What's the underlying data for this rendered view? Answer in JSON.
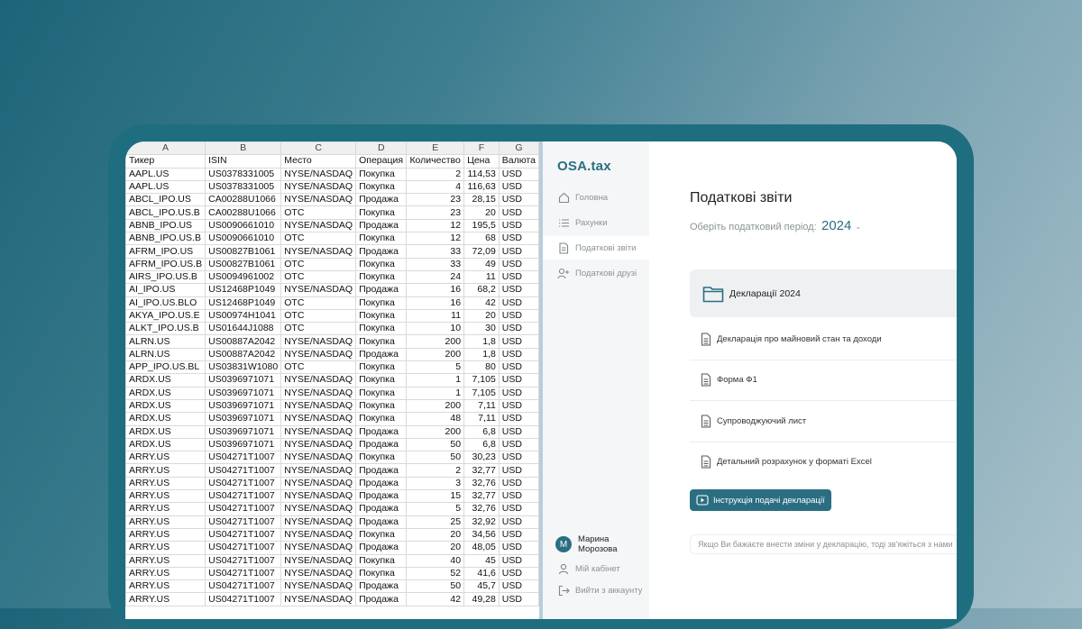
{
  "sheet": {
    "columns": [
      "A",
      "B",
      "C",
      "D",
      "E",
      "F",
      "G"
    ],
    "headers": [
      "Тикер",
      "ISIN",
      "Место",
      "Операция",
      "Количество",
      "Цена",
      "Валюта"
    ],
    "rows": [
      [
        "AAPL.US",
        "US0378331005",
        "NYSE/NASDAQ",
        "Покупка",
        "2",
        "114,53",
        "USD"
      ],
      [
        "AAPL.US",
        "US0378331005",
        "NYSE/NASDAQ",
        "Покупка",
        "4",
        "116,63",
        "USD"
      ],
      [
        "ABCL_IPO.US",
        "CA00288U1066",
        "NYSE/NASDAQ",
        "Продажа",
        "23",
        "28,15",
        "USD"
      ],
      [
        "ABCL_IPO.US.B",
        "CA00288U1066",
        "OTC",
        "Покупка",
        "23",
        "20",
        "USD"
      ],
      [
        "ABNB_IPO.US",
        "US0090661010",
        "NYSE/NASDAQ",
        "Продажа",
        "12",
        "195,5",
        "USD"
      ],
      [
        "ABNB_IPO.US.B",
        "US0090661010",
        "OTC",
        "Покупка",
        "12",
        "68",
        "USD"
      ],
      [
        "AFRM_IPO.US",
        "US00827B1061",
        "NYSE/NASDAQ",
        "Продажа",
        "33",
        "72,09",
        "USD"
      ],
      [
        "AFRM_IPO.US.B",
        "US00827B1061",
        "OTC",
        "Покупка",
        "33",
        "49",
        "USD"
      ],
      [
        "AIRS_IPO.US.B",
        "US0094961002",
        "OTC",
        "Покупка",
        "24",
        "11",
        "USD"
      ],
      [
        "AI_IPO.US",
        "US12468P1049",
        "NYSE/NASDAQ",
        "Продажа",
        "16",
        "68,2",
        "USD"
      ],
      [
        "AI_IPO.US.BLO",
        "US12468P1049",
        "OTC",
        "Покупка",
        "16",
        "42",
        "USD"
      ],
      [
        "AKYA_IPO.US.E",
        "US00974H1041",
        "OTC",
        "Покупка",
        "11",
        "20",
        "USD"
      ],
      [
        "ALKT_IPO.US.B",
        "US01644J1088",
        "OTC",
        "Покупка",
        "10",
        "30",
        "USD"
      ],
      [
        "ALRN.US",
        "US00887A2042",
        "NYSE/NASDAQ",
        "Покупка",
        "200",
        "1,8",
        "USD"
      ],
      [
        "ALRN.US",
        "US00887A2042",
        "NYSE/NASDAQ",
        "Продажа",
        "200",
        "1,8",
        "USD"
      ],
      [
        "APP_IPO.US.BL",
        "US03831W1080",
        "OTC",
        "Покупка",
        "5",
        "80",
        "USD"
      ],
      [
        "ARDX.US",
        "US0396971071",
        "NYSE/NASDAQ",
        "Покупка",
        "1",
        "7,105",
        "USD"
      ],
      [
        "ARDX.US",
        "US0396971071",
        "NYSE/NASDAQ",
        "Покупка",
        "1",
        "7,105",
        "USD"
      ],
      [
        "ARDX.US",
        "US0396971071",
        "NYSE/NASDAQ",
        "Покупка",
        "200",
        "7,11",
        "USD"
      ],
      [
        "ARDX.US",
        "US0396971071",
        "NYSE/NASDAQ",
        "Покупка",
        "48",
        "7,11",
        "USD"
      ],
      [
        "ARDX.US",
        "US0396971071",
        "NYSE/NASDAQ",
        "Продажа",
        "200",
        "6,8",
        "USD"
      ],
      [
        "ARDX.US",
        "US0396971071",
        "NYSE/NASDAQ",
        "Продажа",
        "50",
        "6,8",
        "USD"
      ],
      [
        "ARRY.US",
        "US04271T1007",
        "NYSE/NASDAQ",
        "Покупка",
        "50",
        "30,23",
        "USD"
      ],
      [
        "ARRY.US",
        "US04271T1007",
        "NYSE/NASDAQ",
        "Продажа",
        "2",
        "32,77",
        "USD"
      ],
      [
        "ARRY.US",
        "US04271T1007",
        "NYSE/NASDAQ",
        "Продажа",
        "3",
        "32,76",
        "USD"
      ],
      [
        "ARRY.US",
        "US04271T1007",
        "NYSE/NASDAQ",
        "Продажа",
        "15",
        "32,77",
        "USD"
      ],
      [
        "ARRY.US",
        "US04271T1007",
        "NYSE/NASDAQ",
        "Продажа",
        "5",
        "32,76",
        "USD"
      ],
      [
        "ARRY.US",
        "US04271T1007",
        "NYSE/NASDAQ",
        "Продажа",
        "25",
        "32,92",
        "USD"
      ],
      [
        "ARRY.US",
        "US04271T1007",
        "NYSE/NASDAQ",
        "Покупка",
        "20",
        "34,56",
        "USD"
      ],
      [
        "ARRY.US",
        "US04271T1007",
        "NYSE/NASDAQ",
        "Продажа",
        "20",
        "48,05",
        "USD"
      ],
      [
        "ARRY.US",
        "US04271T1007",
        "NYSE/NASDAQ",
        "Покупка",
        "40",
        "45",
        "USD"
      ],
      [
        "ARRY.US",
        "US04271T1007",
        "NYSE/NASDAQ",
        "Покупка",
        "52",
        "41,6",
        "USD"
      ],
      [
        "ARRY.US",
        "US04271T1007",
        "NYSE/NASDAQ",
        "Продажа",
        "50",
        "45,7",
        "USD"
      ],
      [
        "ARRY.US",
        "US04271T1007",
        "NYSE/NASDAQ",
        "Продажа",
        "42",
        "49,28",
        "USD"
      ]
    ]
  },
  "app": {
    "logo": "OSA.tax",
    "nav": [
      {
        "label": "Головна",
        "icon": "home-icon"
      },
      {
        "label": "Рахунки",
        "icon": "list-icon"
      },
      {
        "label": "Податкові звіти",
        "icon": "document-icon"
      },
      {
        "label": "Податкові друзі",
        "icon": "user-plus-icon"
      }
    ],
    "user": {
      "initial": "M",
      "first_name": "Марина",
      "last_name": "Морозова"
    },
    "account_nav": [
      {
        "label": "Мій кабінет",
        "icon": "user-icon"
      },
      {
        "label": "Вийти з аккаунту",
        "icon": "logout-icon"
      }
    ],
    "main": {
      "title": "Податкові звіти",
      "period_label": "Оберіть податковий період:",
      "period_year": "2024",
      "folder_label": "Декларації 2024",
      "documents": [
        "Декларація про майновий стан та доходи",
        "Форма Ф1",
        "Супроводжуючий лист",
        "Детальний розрахунок у форматі Excel"
      ],
      "instruction_button": "Інструкція подачі декларації",
      "note": "Якщо Ви бажаєте внести зміни у декларацію, тоді зв'яжіться з нами"
    }
  },
  "colors": {
    "accent": "#2b6e82",
    "device": "#1f6e80"
  }
}
